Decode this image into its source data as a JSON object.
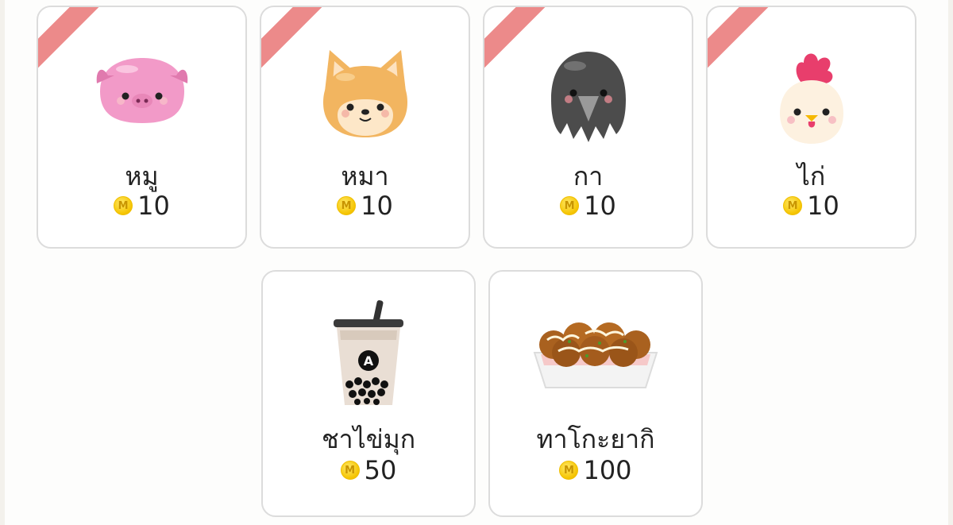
{
  "currency": {
    "coin_symbol": "M",
    "coin_color": "#f5c400"
  },
  "ribbon_color": "#ec8a8a",
  "gifts": [
    {
      "name": "หมู",
      "price": "10",
      "icon": "pig-icon"
    },
    {
      "name": "หมา",
      "price": "10",
      "icon": "dog-icon"
    },
    {
      "name": "กา",
      "price": "10",
      "icon": "crow-icon"
    },
    {
      "name": "ไก่",
      "price": "10",
      "icon": "chicken-icon"
    },
    {
      "name": "ชาไข่มุก",
      "price": "50",
      "icon": "bubble-tea-icon",
      "cup_letter": "A"
    },
    {
      "name": "ทาโกะยากิ",
      "price": "100",
      "icon": "takoyaki-icon"
    }
  ]
}
